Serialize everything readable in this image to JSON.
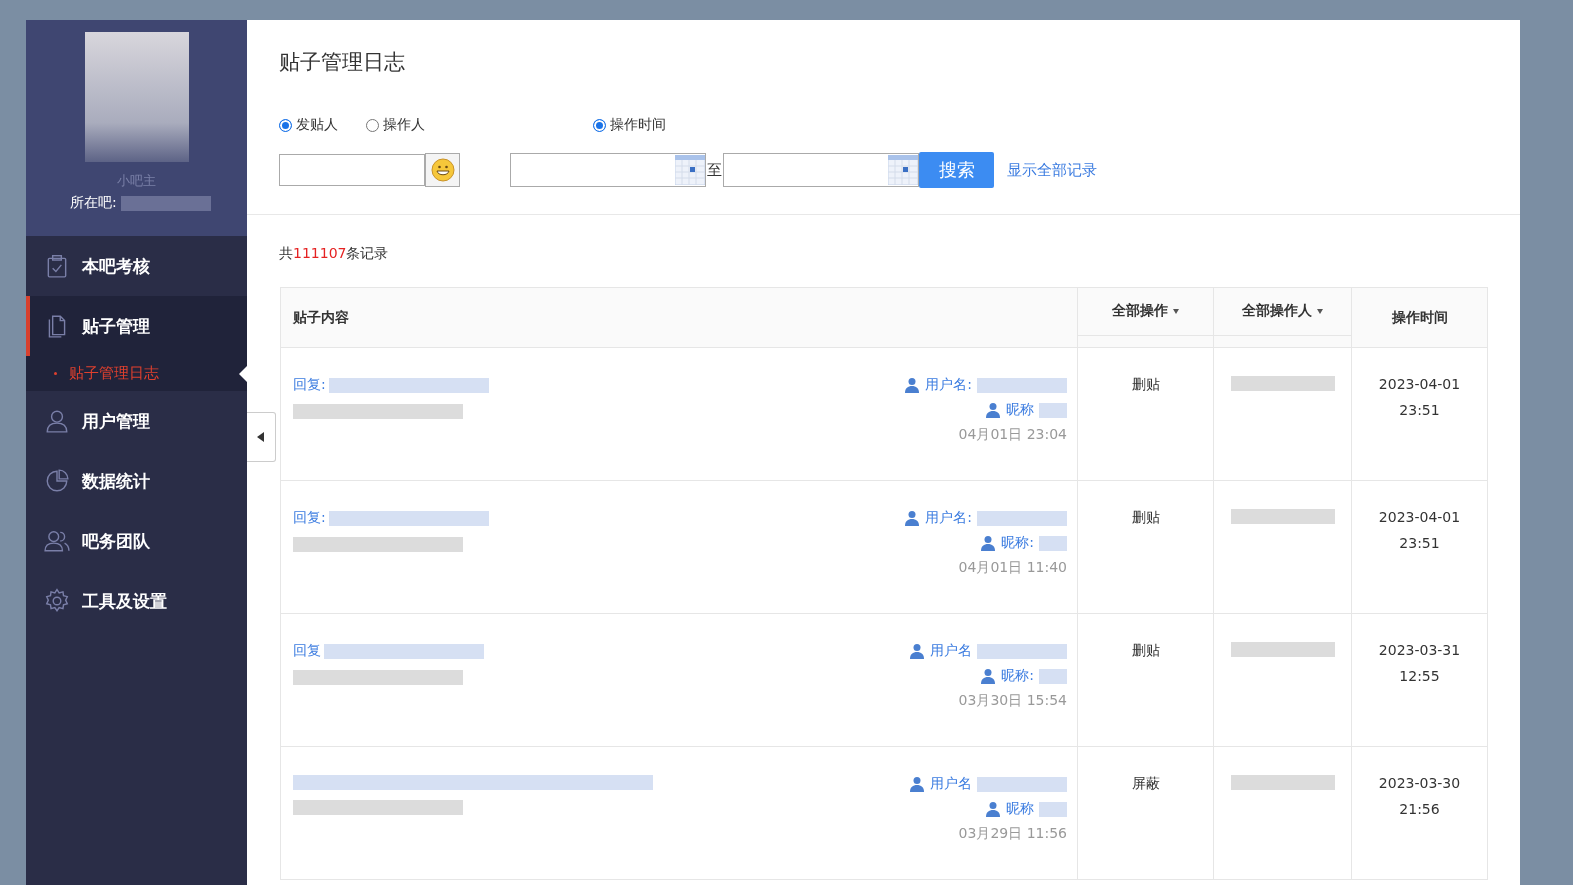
{
  "page": {
    "title": "贴子管理日志"
  },
  "sidebar": {
    "role": "小吧主",
    "forum_label": "所在吧:",
    "menu": [
      {
        "label": "本吧考核",
        "kind": "clipboard",
        "selected": false
      },
      {
        "label": "贴子管理",
        "kind": "documents",
        "selected": true,
        "children": [
          {
            "label": "贴子管理日志",
            "selected": true
          }
        ]
      },
      {
        "label": "用户管理",
        "kind": "person",
        "selected": false
      },
      {
        "label": "数据统计",
        "kind": "pie",
        "selected": false
      },
      {
        "label": "吧务团队",
        "kind": "people",
        "selected": false
      },
      {
        "label": "工具及设置",
        "kind": "gear",
        "selected": false
      }
    ]
  },
  "filters": {
    "person_radios": [
      {
        "label": "发贴人",
        "selected": true
      },
      {
        "label": "操作人",
        "selected": false
      }
    ],
    "time_radio": {
      "label": "操作时间",
      "checked": true
    },
    "range_separator": "至",
    "search_button": "搜索",
    "show_all_link": "显示全部记录"
  },
  "count": {
    "prefix": "共",
    "number": "111107",
    "suffix": "条记录"
  },
  "table": {
    "columns": [
      {
        "label": "贴子内容",
        "dropdown": false
      },
      {
        "label": "全部操作",
        "dropdown": true
      },
      {
        "label": "全部操作人",
        "dropdown": true
      },
      {
        "label": "操作时间",
        "dropdown": false
      }
    ],
    "rows": [
      {
        "reply_label": "回复:",
        "user_label": "用户名:",
        "nick_label": "昵称",
        "post_time": "04月01日 23:04",
        "action": "删贴",
        "op_date": "2023-04-01",
        "op_clock": "23:51"
      },
      {
        "reply_label": "回复:",
        "user_label": "用户名:",
        "nick_label": "昵称:",
        "post_time": "04月01日 11:40",
        "action": "删贴",
        "op_date": "2023-04-01",
        "op_clock": "23:51"
      },
      {
        "reply_label": "回复",
        "user_label": "用户名",
        "nick_label": "昵称:",
        "post_time": "03月30日 15:54",
        "action": "删贴",
        "op_date": "2023-03-31",
        "op_clock": "12:55"
      },
      {
        "user_label": "用户名",
        "nick_label": "昵称",
        "post_time": "03月29日 11:56",
        "action": "屏蔽",
        "op_date": "2023-03-30",
        "op_clock": "21:56"
      }
    ]
  }
}
